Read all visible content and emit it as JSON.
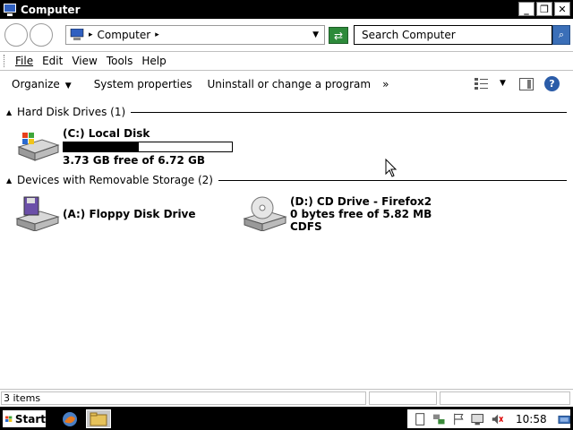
{
  "window": {
    "title": "Computer",
    "min_label": "_",
    "max_label": "❐",
    "close_label": "✕"
  },
  "address": {
    "location": "Computer",
    "separator": "▸",
    "dropdown": "▼",
    "search_placeholder": "Search Computer"
  },
  "menu": {
    "items": [
      "File",
      "Edit",
      "View",
      "Tools",
      "Help"
    ]
  },
  "commands": {
    "organize": "Organize",
    "system_properties": "System properties",
    "uninstall": "Uninstall or change a program",
    "more": "»"
  },
  "groups": {
    "hard_disks": {
      "title": "Hard Disk Drives (1)",
      "drives": [
        {
          "name": "(C:) Local Disk",
          "free_text": "3.73 GB free of 6.72 GB",
          "used_fraction": 0.445
        }
      ]
    },
    "removable": {
      "title": "Devices with Removable Storage (2)",
      "drives": [
        {
          "name": "(A:) Floppy Disk Drive"
        },
        {
          "name": "(D:) CD Drive - Firefox2",
          "free_text": "0 bytes free of 5.82 MB",
          "fs": "CDFS"
        }
      ]
    }
  },
  "status": {
    "items_text": "3 items"
  },
  "taskbar": {
    "start_label": "Start",
    "clock": "10:58"
  },
  "colors": {
    "titlebar": "#000000",
    "taskbar": "#000000",
    "refresh": "#2d8a3a",
    "search_button": "#3b6fb8"
  }
}
